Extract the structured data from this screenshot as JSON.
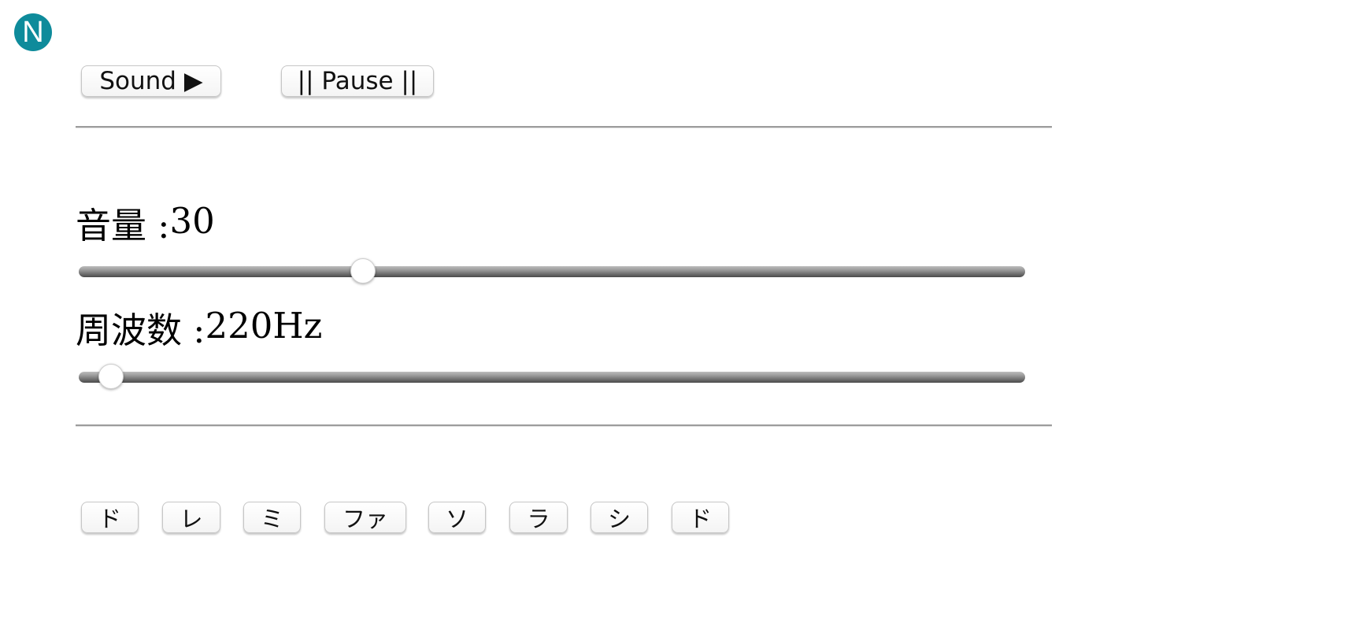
{
  "logo": {
    "letter": "N",
    "color": "#0e8b9b"
  },
  "controls": {
    "sound_label": "Sound ▶",
    "pause_label": "|| Pause ||"
  },
  "volume": {
    "name": "音量 : ",
    "value": "30",
    "level_fraction": 0.3
  },
  "frequency": {
    "name": "周波数 : ",
    "value": "220Hz",
    "level_fraction": 0.034
  },
  "notes": [
    "ド",
    "レ",
    "ミ",
    "ファ",
    "ソ",
    "ラ",
    "シ",
    "ド"
  ]
}
